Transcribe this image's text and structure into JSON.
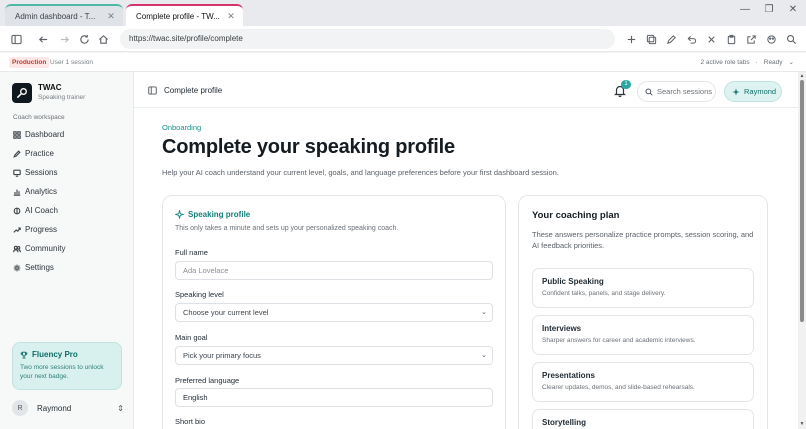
{
  "browser": {
    "tabs": [
      {
        "title": "Admin dashboard - T..."
      },
      {
        "title": "Complete profile - TW..."
      }
    ],
    "url": "https://twac.site/profile/complete"
  },
  "env": {
    "badge": "Production",
    "session": "User 1 session",
    "role_tabs": "2 active role tabs",
    "separator": "·",
    "status": "Ready"
  },
  "sidebar": {
    "brand": "TWAC",
    "tagline": "Speaking trainer",
    "section": "Coach workspace",
    "items": [
      {
        "label": "Dashboard",
        "icon": "grid-icon"
      },
      {
        "label": "Practice",
        "icon": "pen-icon"
      },
      {
        "label": "Sessions",
        "icon": "monitor-icon"
      },
      {
        "label": "Analytics",
        "icon": "bar-chart-icon"
      },
      {
        "label": "AI Coach",
        "icon": "brain-icon"
      },
      {
        "label": "Progress",
        "icon": "trend-icon"
      },
      {
        "label": "Community",
        "icon": "users-icon"
      },
      {
        "label": "Settings",
        "icon": "gear-icon"
      }
    ],
    "promo": {
      "title": "Fluency Pro",
      "text": "Two more sessions to unlock your next badge."
    },
    "user": {
      "initial": "R",
      "name": "Raymond"
    }
  },
  "topbar": {
    "title": "Complete profile",
    "notification_count": "1",
    "search_label": "Search sessions",
    "user_label": "Raymond"
  },
  "page": {
    "eyebrow": "Onboarding",
    "title": "Complete your speaking profile",
    "description": "Help your AI coach understand your current level, goals, and language preferences before your first dashboard session."
  },
  "form": {
    "heading": "Speaking profile",
    "subheading": "This only takes a minute and sets up your personalized speaking coach.",
    "full_name": {
      "label": "Full name",
      "placeholder": "Ada Lovelace"
    },
    "level": {
      "label": "Speaking level",
      "selected": "Choose your current level"
    },
    "goal": {
      "label": "Main goal",
      "selected": "Pick your primary focus"
    },
    "language": {
      "label": "Preferred language",
      "value": "English"
    },
    "bio": {
      "label": "Short bio"
    }
  },
  "plan": {
    "title": "Your coaching plan",
    "description": "These answers personalize practice prompts, session scoring, and AI feedback priorities.",
    "items": [
      {
        "title": "Public Speaking",
        "desc": "Confident talks, panels, and stage delivery."
      },
      {
        "title": "Interviews",
        "desc": "Sharper answers for career and academic interviews."
      },
      {
        "title": "Presentations",
        "desc": "Clearer updates, demos, and slide-based rehearsals."
      },
      {
        "title": "Storytelling",
        "desc": ""
      }
    ]
  },
  "colors": {
    "accent": "#15928a",
    "danger": "#c0392b",
    "promo_bg": "#d8f1ef"
  }
}
